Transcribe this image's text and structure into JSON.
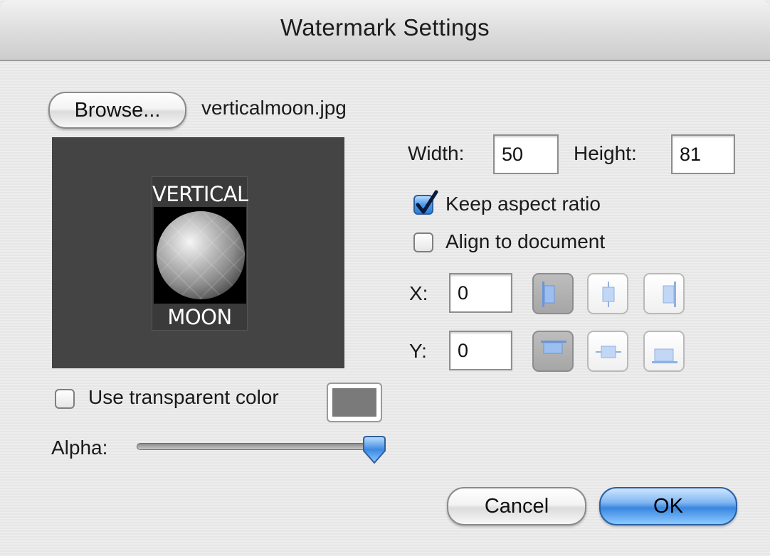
{
  "window": {
    "title": "Watermark Settings"
  },
  "browse": {
    "button_label": "Browse...",
    "filename": "verticalmoon.jpg"
  },
  "preview": {
    "image_top_text": "VERTICAL",
    "image_bottom_text": "MOON"
  },
  "size": {
    "width_label": "Width:",
    "width_value": "50",
    "height_label": "Height:",
    "height_value": "81"
  },
  "options": {
    "keep_aspect_label": "Keep aspect ratio",
    "keep_aspect_checked": true,
    "align_doc_label": "Align to document",
    "align_doc_checked": false
  },
  "position": {
    "x_label": "X:",
    "x_value": "0",
    "y_label": "Y:",
    "y_value": "0"
  },
  "transparent": {
    "label": "Use transparent color",
    "checked": false,
    "swatch_color": "#7a7a7a"
  },
  "alpha": {
    "label": "Alpha:",
    "value": 1.0
  },
  "buttons": {
    "cancel": "Cancel",
    "ok": "OK"
  }
}
